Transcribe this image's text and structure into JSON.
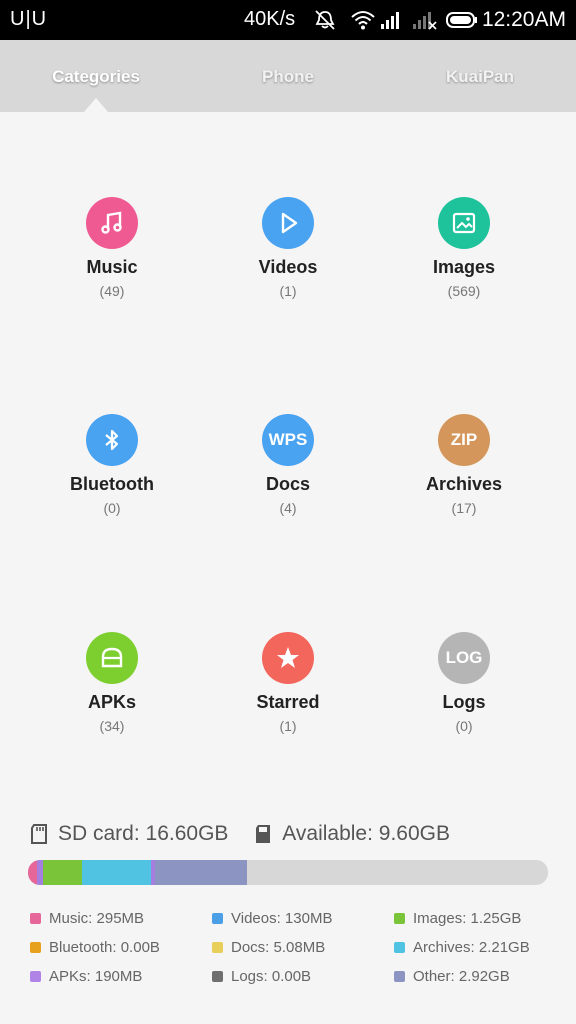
{
  "status_bar": {
    "left_text": "U|U",
    "speed": "40K/s",
    "time": "12:20AM",
    "icons": [
      "mute-icon",
      "wifi-icon",
      "signal-icon",
      "signal-no-service-icon",
      "battery-icon"
    ]
  },
  "tabs": [
    {
      "label": "Categories",
      "active": true
    },
    {
      "label": "Phone",
      "active": false
    },
    {
      "label": "KuaiPan",
      "active": false
    }
  ],
  "categories": [
    {
      "name": "Music",
      "count": "(49)",
      "icon": "music-note-icon",
      "color": "#f05a93"
    },
    {
      "name": "Videos",
      "count": "(1)",
      "icon": "play-icon",
      "color": "#4aa3f0"
    },
    {
      "name": "Images",
      "count": "(569)",
      "icon": "image-icon",
      "color": "#1ec29b"
    },
    {
      "name": "Bluetooth",
      "count": "(0)",
      "icon": "bluetooth-icon",
      "color": "#4aa3f0"
    },
    {
      "name": "Docs",
      "count": "(4)",
      "icon": "wps-doc-icon",
      "icon_text": "WPS",
      "color": "#4aa3f0"
    },
    {
      "name": "Archives",
      "count": "(17)",
      "icon": "zip-archive-icon",
      "icon_text": "ZIP",
      "color": "#d4965a"
    },
    {
      "name": "APKs",
      "count": "(34)",
      "icon": "android-apk-icon",
      "color": "#7ccf2e"
    },
    {
      "name": "Starred",
      "count": "(1)",
      "icon": "star-icon",
      "color": "#f3665c"
    },
    {
      "name": "Logs",
      "count": "(0)",
      "icon": "log-icon",
      "icon_text": "LOG",
      "color": "#b5b5b5"
    }
  ],
  "storage": {
    "sd_card_label": "SD card: 16.60GB",
    "available_label": "Available: 9.60GB",
    "usage_fractions": [
      {
        "name": "Music",
        "fraction": 0.018,
        "color": "#e6669a"
      },
      {
        "name": "APKs",
        "fraction": 0.011,
        "color": "#a57fe0"
      },
      {
        "name": "Images",
        "fraction": 0.075,
        "color": "#7ac43a"
      },
      {
        "name": "Archives",
        "fraction": 0.133,
        "color": "#4fc3e1"
      },
      {
        "name": "Videos",
        "fraction": 0.008,
        "color": "#a57fe0"
      },
      {
        "name": "Other",
        "fraction": 0.176,
        "color": "#8c95c2"
      }
    ]
  },
  "legend": [
    {
      "label": "Music: 295MB",
      "color": "#e6669a"
    },
    {
      "label": "Videos: 130MB",
      "color": "#4a9fe6"
    },
    {
      "label": "Images: 1.25GB",
      "color": "#7ac43a"
    },
    {
      "label": "Bluetooth: 0.00B",
      "color": "#e8a11f"
    },
    {
      "label": "Docs: 5.08MB",
      "color": "#e8cf5a"
    },
    {
      "label": "Archives: 2.21GB",
      "color": "#4fc3e1"
    },
    {
      "label": "APKs: 190MB",
      "color": "#b083e6"
    },
    {
      "label": "Logs: 0.00B",
      "color": "#6f6f6f"
    },
    {
      "label": "Other: 2.92GB",
      "color": "#8c95c2"
    }
  ]
}
